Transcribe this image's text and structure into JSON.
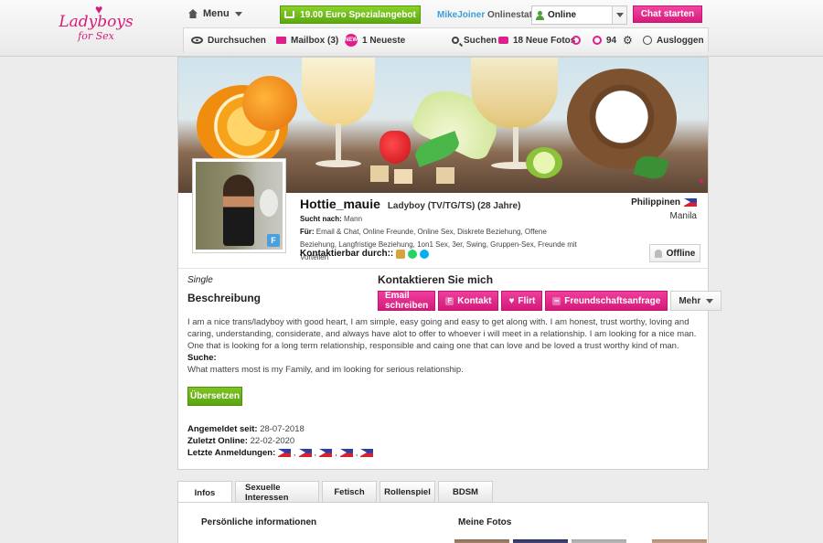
{
  "brand": {
    "line1": "Ladyboys",
    "line2": "for Sex"
  },
  "header": {
    "menu_label": "Menu",
    "promo_label": "19.00 Euro Spezialangebot",
    "username": "MikeJoiner",
    "onlinestatus_label": "Onlinestatus",
    "status_value": "Online",
    "chat_label": "Chat starten"
  },
  "nav": {
    "browse": "Durchsuchen",
    "mailbox": "Mailbox (3)",
    "newest": "1 Neueste",
    "search": "Suchen",
    "photos": "18 Neue Fotos",
    "count": "94",
    "logout": "Ausloggen",
    "new_badge": "NEW"
  },
  "profile": {
    "name": "Hottie_mauie",
    "meta": "Ladyboy (TV/TG/TS) (28 Jahre)",
    "seeks_label": "Sucht nach:",
    "seeks_value": "Mann",
    "for_label": "Für:",
    "for_value": "Email & Chat, Online Freunde, Online Sex, Diskrete Beziehung, Offene Beziehung, Langfristige Beziehung, 1on1 Sex, 3er, Swing, Gruppen-Sex, Freunde mit Vorteilen",
    "contactable_label": "Kontaktierbar durch::",
    "country": "Philippinen",
    "city": "Manila",
    "status": "Offline",
    "relationship": "Single",
    "description_title": "Beschreibung",
    "description": "I am a nice trans/ladyboy with good heart, I am simple, easy going and easy to get along with. I am honest, trust worthy, loving and caring, understanding, considerate, and always have alot to offer to whoever i will meet in a relationship. I am looking for a nice man. One that is looking for a long term relationship, responsible and caing one that can love and be loved a trust worthy kind of man.",
    "search_label": "Suche:",
    "search_text": "What matters most is my Family, and im looking for serious relationship.",
    "translate_label": "Übersetzen",
    "registered_label": "Angemeldet seit:",
    "registered_value": "28-07-2018",
    "last_online_label": "Zuletzt Online:",
    "last_online_value": "22-02-2020",
    "last_logins_label": "Letzte Anmeldungen:"
  },
  "contact": {
    "title": "Kontaktieren Sie mich",
    "email": "Email schreiben",
    "kontakt": "Kontakt",
    "flirt": "Flirt",
    "friend": "Freundschaftsanfrage",
    "more": "Mehr"
  },
  "tabs": [
    "Infos",
    "Sexuelle Interessen",
    "Fetisch",
    "Rollenspiel",
    "BDSM"
  ],
  "panel": {
    "personal_title": "Persönliche informationen",
    "photos_title": "Meine Fotos"
  },
  "colors": {
    "accent_pink": "#d81b7a",
    "accent_green": "#5ea810",
    "link_blue": "#3aa0d9"
  }
}
